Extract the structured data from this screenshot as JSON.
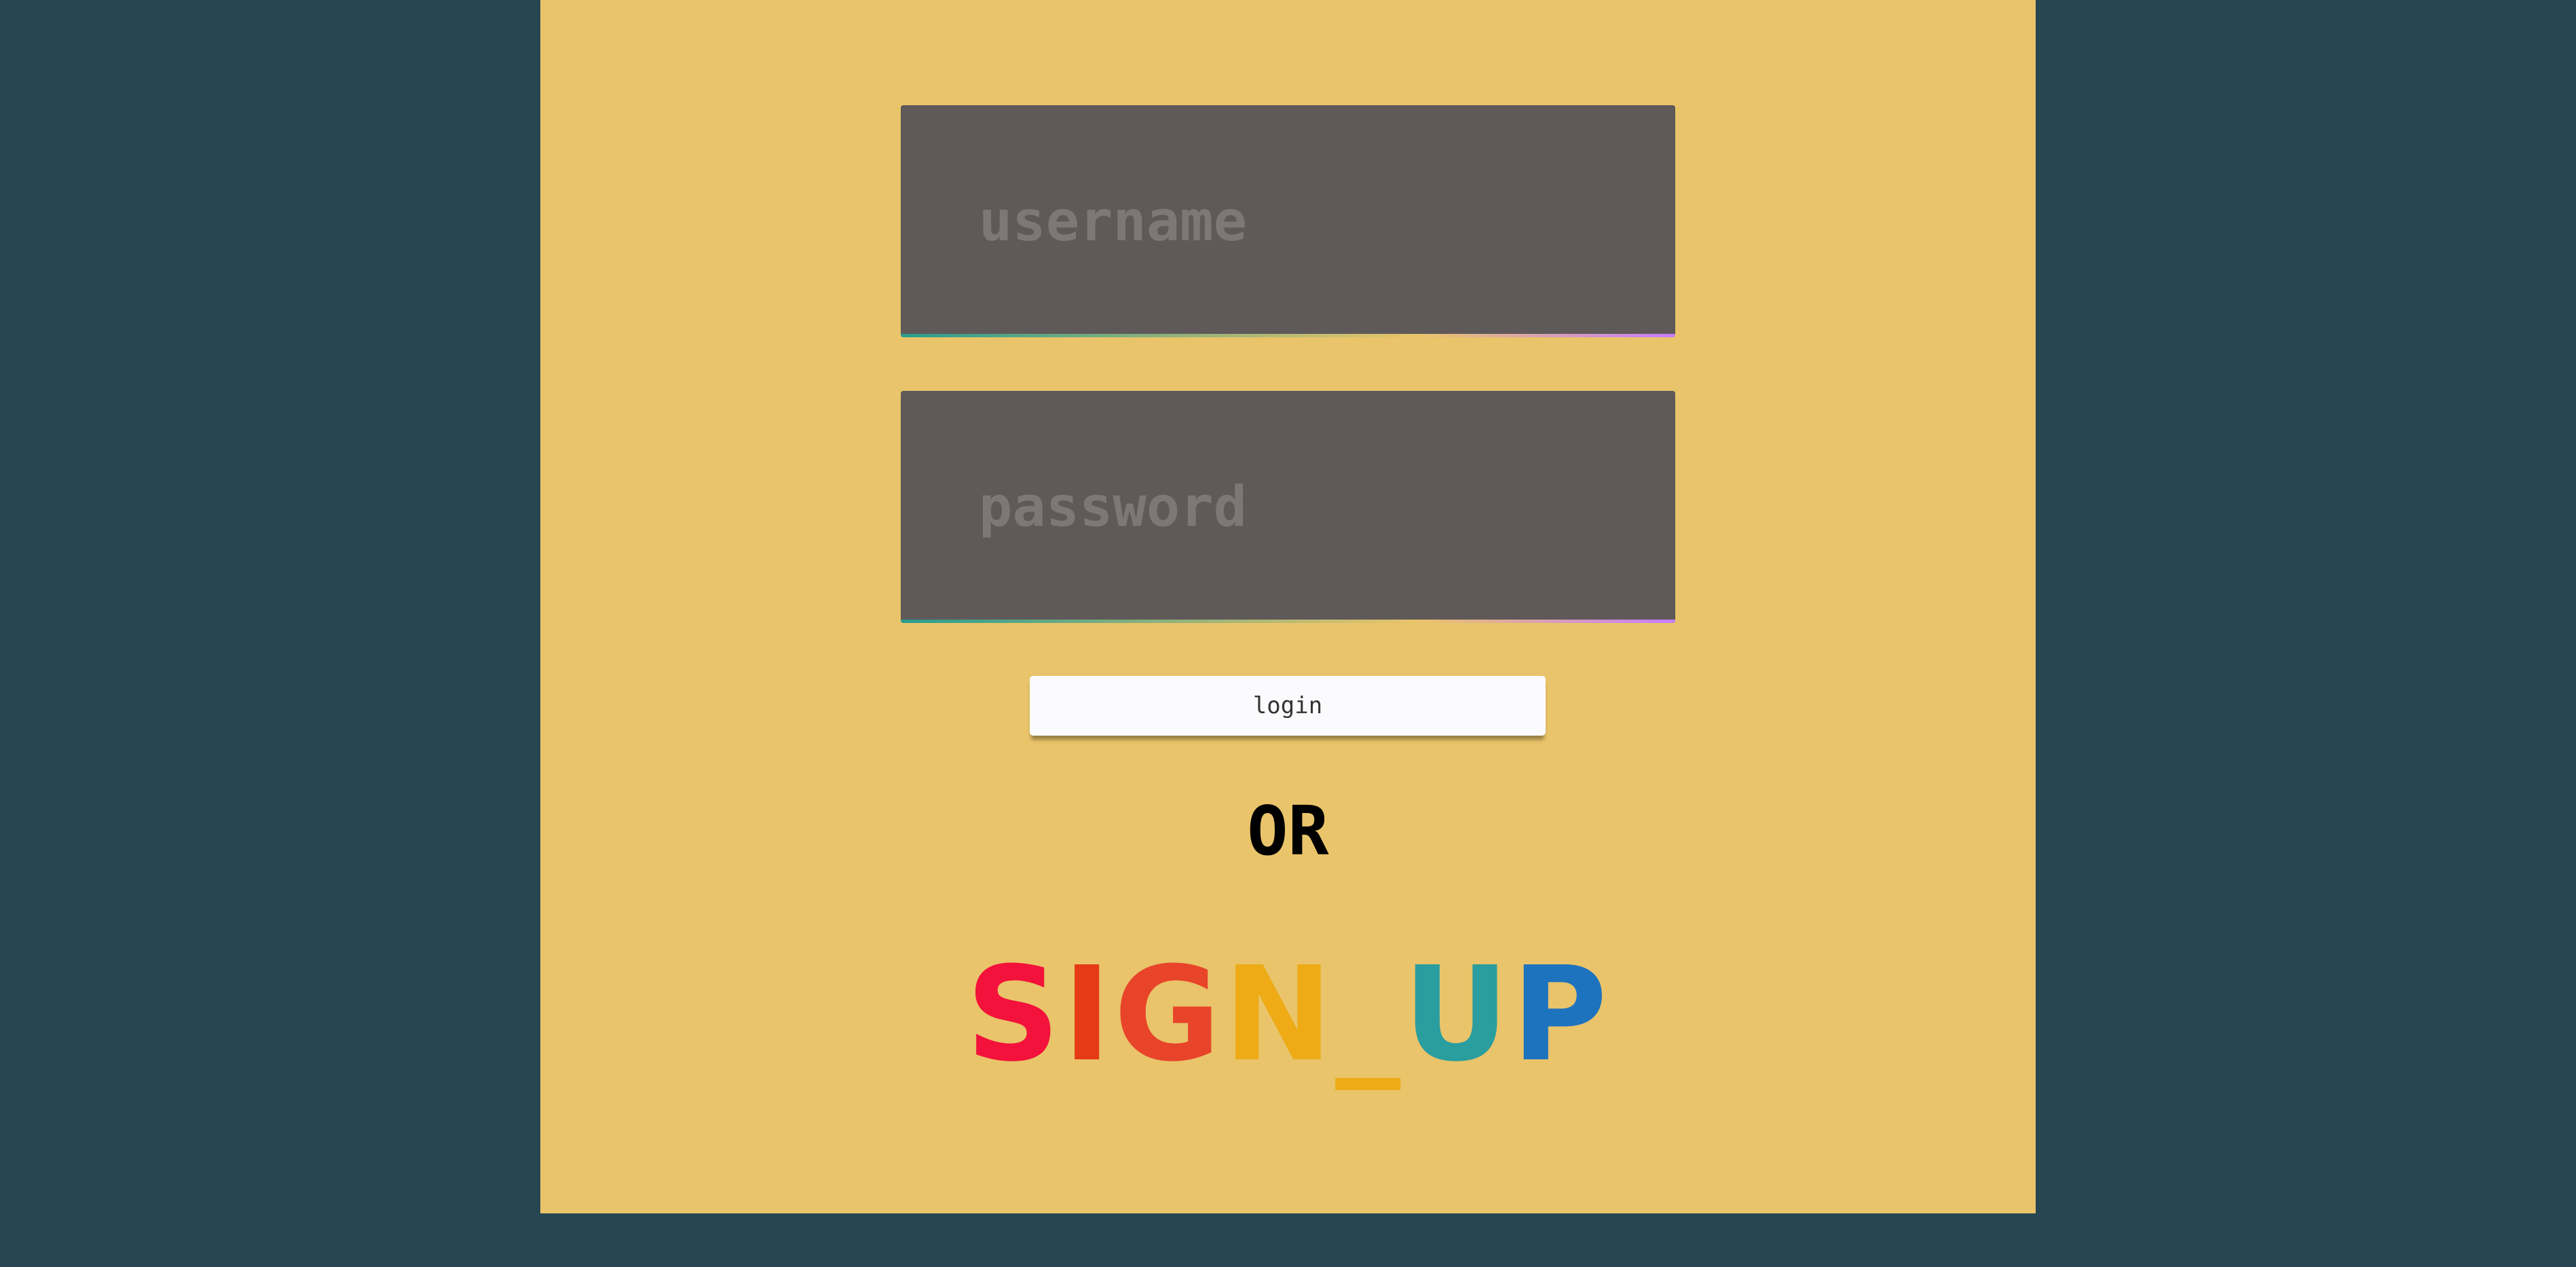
{
  "login_form": {
    "username_placeholder": "username",
    "password_placeholder": "password",
    "login_label": "login"
  },
  "separator": "OR",
  "signup": {
    "letters": [
      "S",
      "I",
      "G",
      "N",
      "_",
      "U",
      "P"
    ],
    "colors": {
      "S": "#f3123b",
      "I": "#e63a17",
      "G": "#e8442a",
      "N": "#eeab16",
      "_": "#eeab16",
      "U": "#2a9d9f",
      "P": "#1e73be"
    }
  },
  "theme": {
    "outer_background": "#264653",
    "panel_background": "#e9c46a",
    "field_background": "#5f5a59"
  }
}
